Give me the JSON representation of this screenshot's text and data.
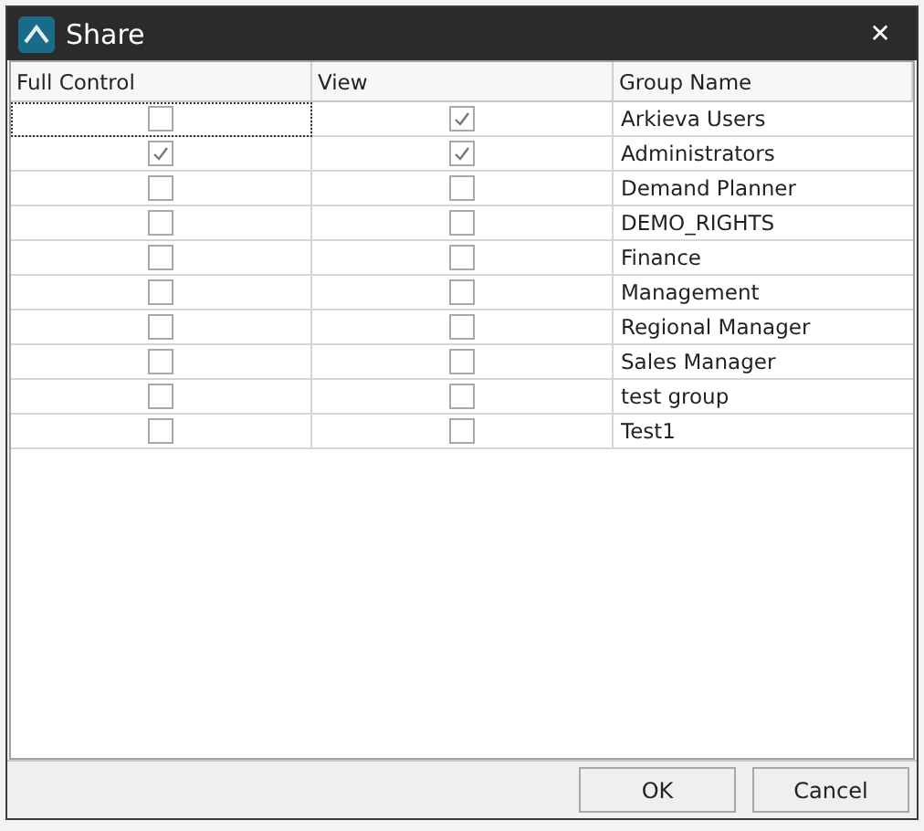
{
  "window": {
    "title": "Share",
    "close": "✕"
  },
  "table": {
    "columns": [
      "Full Control",
      "View",
      "Group Name"
    ],
    "rows": [
      {
        "full_control": false,
        "view": true,
        "group": "Arkieva Users",
        "focused": true
      },
      {
        "full_control": true,
        "view": true,
        "group": "Administrators",
        "focused": false
      },
      {
        "full_control": false,
        "view": false,
        "group": "Demand Planner",
        "focused": false
      },
      {
        "full_control": false,
        "view": false,
        "group": "DEMO_RIGHTS",
        "focused": false
      },
      {
        "full_control": false,
        "view": false,
        "group": "Finance",
        "focused": false
      },
      {
        "full_control": false,
        "view": false,
        "group": "Management",
        "focused": false
      },
      {
        "full_control": false,
        "view": false,
        "group": "Regional Manager",
        "focused": false
      },
      {
        "full_control": false,
        "view": false,
        "group": "Sales Manager",
        "focused": false
      },
      {
        "full_control": false,
        "view": false,
        "group": "test group",
        "focused": false
      },
      {
        "full_control": false,
        "view": false,
        "group": "Test1",
        "focused": false
      }
    ]
  },
  "buttons": [
    "OK",
    "Cancel"
  ]
}
